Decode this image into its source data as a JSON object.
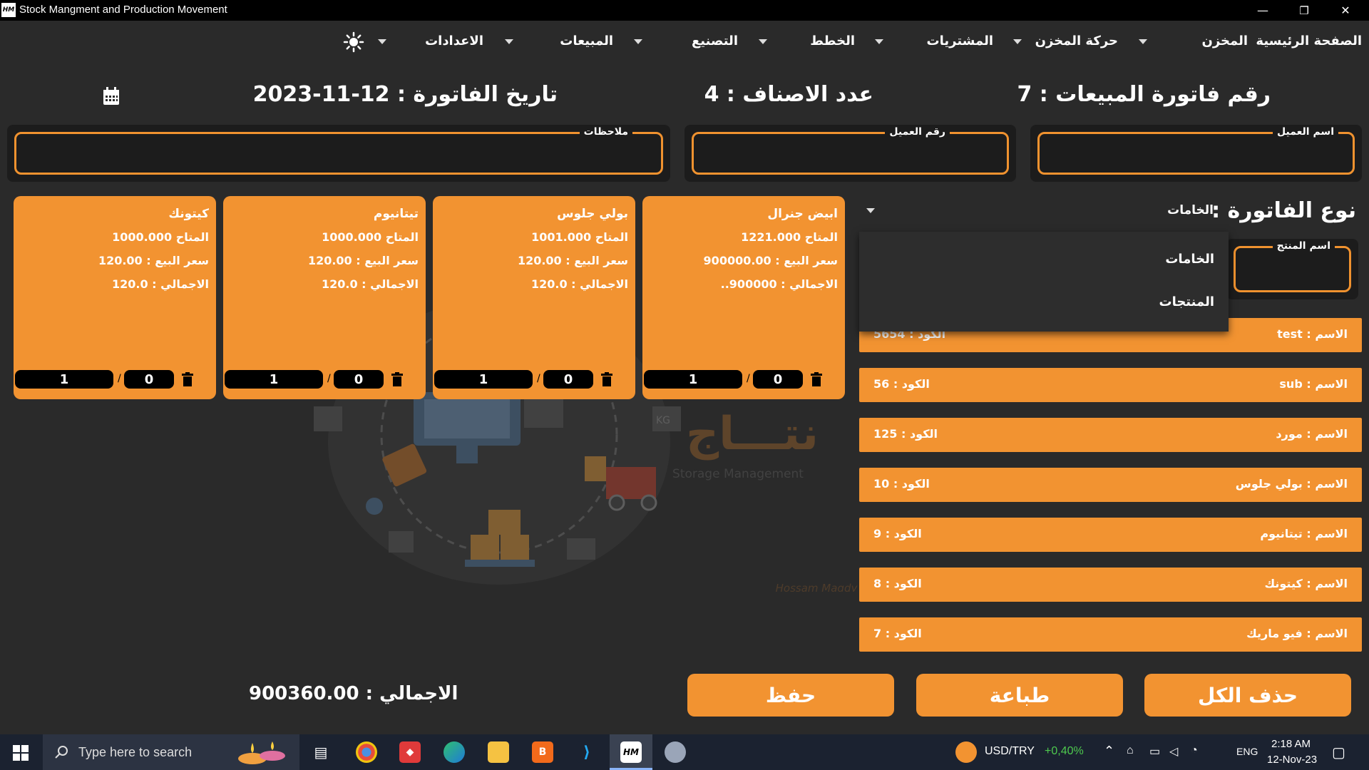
{
  "window": {
    "title": "Stock Mangment and Production Movement",
    "app_icon_text": "HM",
    "minimize": "—",
    "restore": "❐",
    "close": "✕"
  },
  "menu": {
    "home": "الصفحة الرئيسية",
    "warehouse": "المخزن",
    "warehouse_movement": "حركة المخزن",
    "purchases": "المشتريات",
    "plans": "الخطط",
    "manufacturing": "التصنيع",
    "sales": "المبيعات",
    "settings": "الاعدادات",
    "theme_icon": "sun-icon"
  },
  "header": {
    "invoice_number": "رقم فاتورة المبيعات : 7",
    "items_count": "عدد الاصناف : 4",
    "invoice_date": "تاريخ الفاتورة : 12-11-2023",
    "calendar_icon": "calendar-icon"
  },
  "fields": {
    "customer_name_label": "اسم العميل",
    "customer_name_value": "",
    "customer_number_label": "رقم العميل",
    "customer_number_value": "",
    "notes_label": "ملاحظات",
    "notes_value": "",
    "product_name_label": "اسم المنتج",
    "product_name_value": ""
  },
  "cards": [
    {
      "name": "ابيض جنرال",
      "available": "المتاح 1221.000",
      "price": "سعر البيع : 900000.00",
      "total": "الاجمالي : 900000..",
      "qty": "1",
      "extra": "0"
    },
    {
      "name": "بولي جلوس",
      "available": "المتاح 1001.000",
      "price": "سعر البيع : 120.00",
      "total": "الاجمالي : 120.0",
      "qty": "1",
      "extra": "0"
    },
    {
      "name": "تيتانيوم",
      "available": "المتاح 1000.000",
      "price": "سعر البيع : 120.00",
      "total": "الاجمالي : 120.0",
      "qty": "1",
      "extra": "0"
    },
    {
      "name": "كيتونك",
      "available": "المتاح 1000.000",
      "price": "سعر البيع : 120.00",
      "total": "الاجمالي : 120.0",
      "qty": "1",
      "extra": "0"
    }
  ],
  "invoice_type": {
    "label": "نوع الفاتورة :",
    "selected": "الخامات",
    "options": [
      "الخامات",
      "المنتجات"
    ]
  },
  "product_list": [
    {
      "name": "الاسم : test",
      "code": "الكود : 5654"
    },
    {
      "name": "الاسم : sub",
      "code": "الكود : 56"
    },
    {
      "name": "الاسم : مورد",
      "code": "الكود : 125"
    },
    {
      "name": "الاسم : بولي جلوس",
      "code": "الكود : 10"
    },
    {
      "name": "الاسم : تيتانيوم",
      "code": "الكود : 9"
    },
    {
      "name": "الاسم : كيتونك",
      "code": "الكود : 8"
    },
    {
      "name": "الاسم : فيو ماريك",
      "code": "الكود : 7"
    }
  ],
  "footer": {
    "delete_all": "حذف الكل",
    "print": "طباعة",
    "save": "حفظ",
    "total_label": "الاجمالي",
    "total_value": "900360.00"
  },
  "watermark": {
    "brand_text": "نتـــاج",
    "brand_sub": "Storage Management",
    "author": "Hossam Magdy"
  },
  "taskbar": {
    "search_placeholder": "Type here to search",
    "currency": "USD/TRY",
    "currency_change": "+0,40%",
    "language": "ENG",
    "time": "2:18 AM",
    "date": "12-Nov-23"
  }
}
